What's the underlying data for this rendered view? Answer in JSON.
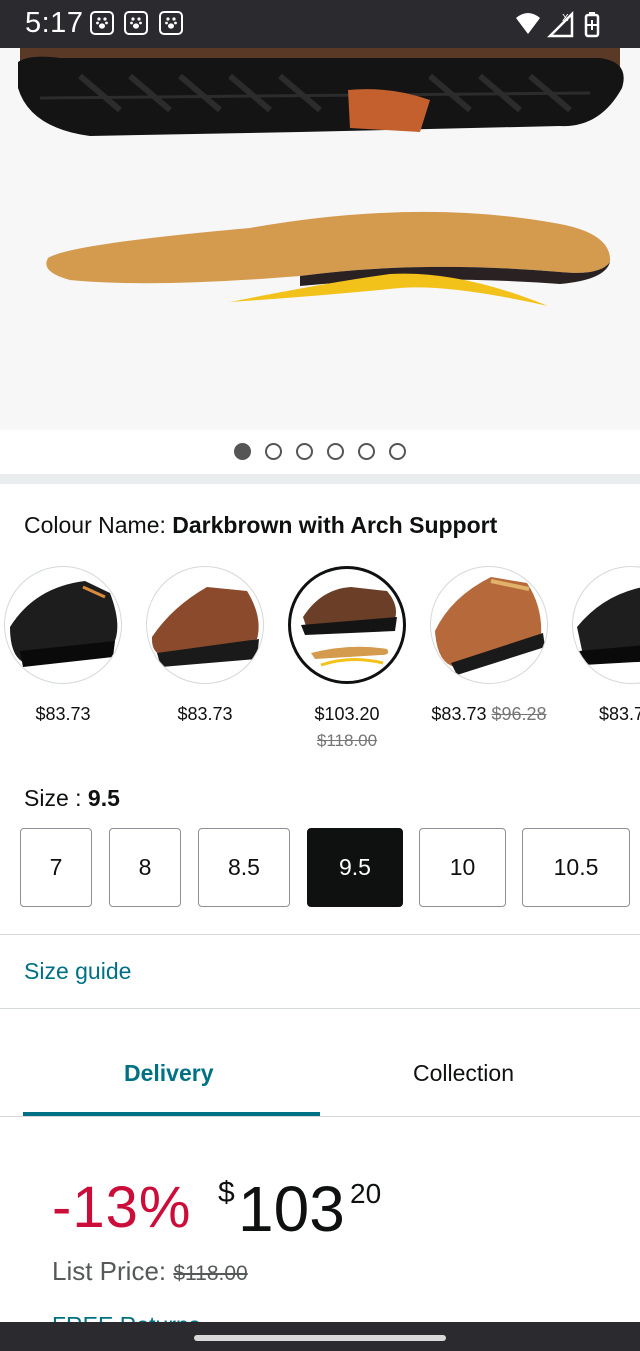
{
  "status_bar": {
    "time": "5:17",
    "notification_icons": [
      "paw-icon",
      "paw-icon",
      "paw-icon"
    ],
    "system_icons": [
      "wifi-icon",
      "signal-icon",
      "battery-icon"
    ]
  },
  "gallery": {
    "image_count": 6,
    "active_index": 0
  },
  "colour": {
    "label": "Colour Name: ",
    "value": "Darkbrown with Arch Support",
    "options": [
      {
        "price": "$83.73",
        "was": ""
      },
      {
        "price": "$83.73",
        "was": ""
      },
      {
        "price": "$103.20",
        "was": "$118.00"
      },
      {
        "price": "$83.73",
        "was": "$96.28"
      },
      {
        "price": "$83.7",
        "was": ""
      }
    ],
    "selected_index": 2
  },
  "size": {
    "label": "Size : ",
    "value": "9.5",
    "options": [
      "7",
      "8",
      "8.5",
      "9.5",
      "10",
      "10.5"
    ],
    "selected_index": 3
  },
  "size_guide": "Size guide",
  "tabs": {
    "delivery": "Delivery",
    "collection": "Collection",
    "active": "Delivery"
  },
  "pricing": {
    "discount": "-13%",
    "currency": "$",
    "whole": "103",
    "fraction": "20",
    "list_price_label": "List Price: ",
    "list_price": "$118.00"
  },
  "free_returns": "FREE Returns",
  "colors": {
    "accent": "#007185",
    "discount": "#cc0c39",
    "selected": "#0f1111",
    "status_bar": "#2b2b2f"
  }
}
